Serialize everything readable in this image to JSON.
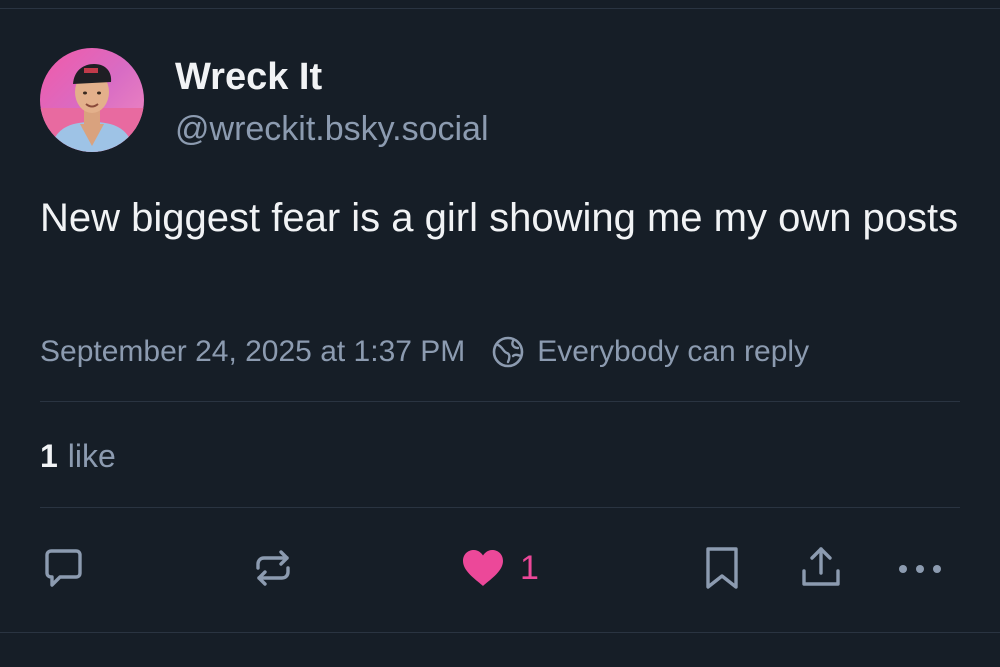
{
  "author": {
    "display_name": "Wreck It",
    "handle": "@wreckit.bsky.social",
    "avatar_icon": "profile-photo"
  },
  "post": {
    "text": "New biggest fear is a girl showing me my own posts",
    "timestamp": "September 24, 2025 at 1:37 PM",
    "reply_setting": "Everybody can reply",
    "reply_setting_icon": "globe-icon"
  },
  "stats": {
    "like_count": "1",
    "like_label": "like"
  },
  "actions": {
    "reply_icon": "reply-icon",
    "repost_icon": "repost-icon",
    "like_icon": "heart-icon",
    "like_count": "1",
    "bookmark_icon": "bookmark-icon",
    "share_icon": "share-icon",
    "more_icon": "more-icon"
  },
  "colors": {
    "background": "#161e27",
    "text_primary": "#f1f3f5",
    "text_secondary": "#8c9bb0",
    "divider": "#2a3441",
    "like_active": "#ec4899"
  }
}
